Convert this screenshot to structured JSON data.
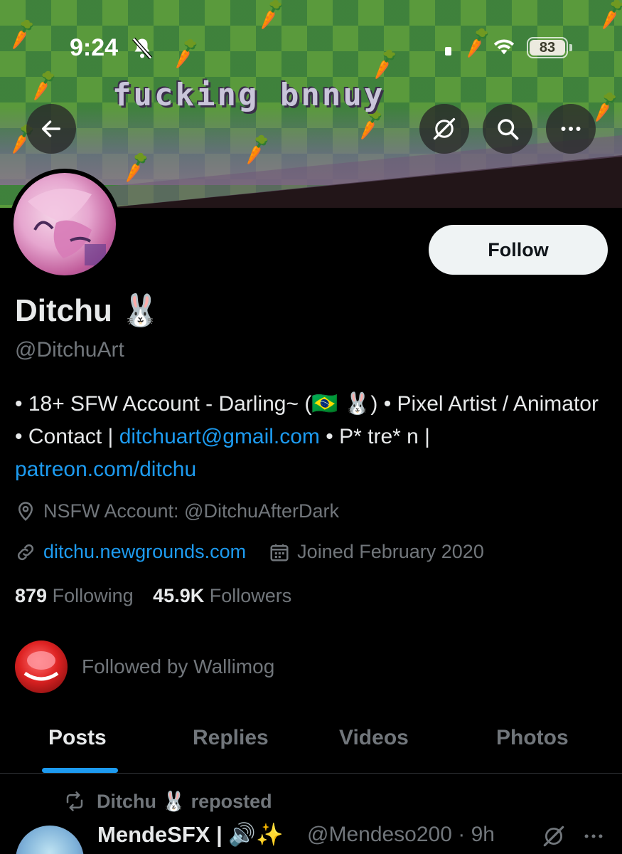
{
  "status_bar": {
    "time": "9:24",
    "battery": "83",
    "icons": [
      "bell-slash-icon",
      "signal-icon",
      "wifi-icon",
      "battery-icon"
    ]
  },
  "banner": {
    "text": "fucking bnnuy"
  },
  "top_actions": {
    "icons": [
      "back-arrow-icon",
      "grok-slash-icon",
      "search-icon",
      "more-icon"
    ]
  },
  "profile": {
    "follow_label": "Follow",
    "display_name": "Ditchu 🐰",
    "handle": "@DitchuArt",
    "bio": {
      "part1": "• 18+ SFW Account - Darling~ (🇧🇷 🐰) • Pixel Artist / Animator • Contact | ",
      "email": "ditchuart@gmail.com",
      "part2": " • P* tre* n | ",
      "patreon": "patreon.com/ditchu"
    },
    "location": "NSFW Account: @DitchuAfterDark",
    "website": "ditchu.newgrounds.com",
    "joined": "Joined February 2020",
    "following_count": "879",
    "following_label": "Following",
    "followers_count": "45.9K",
    "followers_label": "Followers",
    "followed_by": "Followed by Wallimog"
  },
  "tabs": [
    {
      "label": "Posts",
      "active": true
    },
    {
      "label": "Replies",
      "active": false
    },
    {
      "label": "Videos",
      "active": false
    },
    {
      "label": "Photos",
      "active": false
    }
  ],
  "post": {
    "repost_label": "Ditchu 🐰 reposted",
    "author_name": "MendeSFX | 🔊✨",
    "author_handle": "@Mendeso200 · 9h"
  },
  "colors": {
    "background": "#000000",
    "text": "#e7e9ea",
    "muted": "#71767b",
    "accent": "#1d9bf0",
    "follow_button": "#eff3f4"
  }
}
